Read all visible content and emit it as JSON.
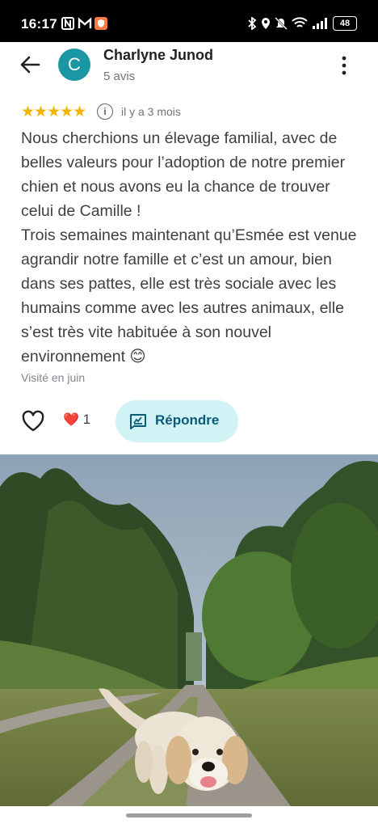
{
  "status_bar": {
    "time": "16:17",
    "battery": "48",
    "left_icons": [
      "nfc-icon",
      "gmail-icon",
      "shield-app-icon"
    ],
    "right_icons": [
      "bluetooth-icon",
      "location-icon",
      "mute-icon",
      "wifi-icon",
      "signal-icon",
      "battery-icon"
    ]
  },
  "header": {
    "avatar_letter": "C",
    "user_name": "Charlyne Junod",
    "review_count": "5 avis",
    "colors": {
      "avatar": "#1a97a3"
    }
  },
  "review": {
    "stars": "★★★★★",
    "rating": 5,
    "date": "il y a 3 mois",
    "text": "Nous cherchions un élevage familial, avec de belles valeurs pour l’adoption de notre premier chien et nous avons eu la chance de trouver celui de Camille !\nTrois semaines maintenant qu’Esmée est venue agrandir notre famille et c’est un amour, bien dans ses pattes, elle est très sociale avec les humains comme avec les autres animaux, elle s’est très vite habituée à son nouvel environnement 😊",
    "visited": "Visité en juin"
  },
  "actions": {
    "heart_emoji": "❤️",
    "likes_count": "1",
    "reply_label": "Répondre"
  },
  "colors": {
    "stars": "#f4b400",
    "reply_bg": "#d2f3f6",
    "reply_text": "#0a5a7a"
  }
}
